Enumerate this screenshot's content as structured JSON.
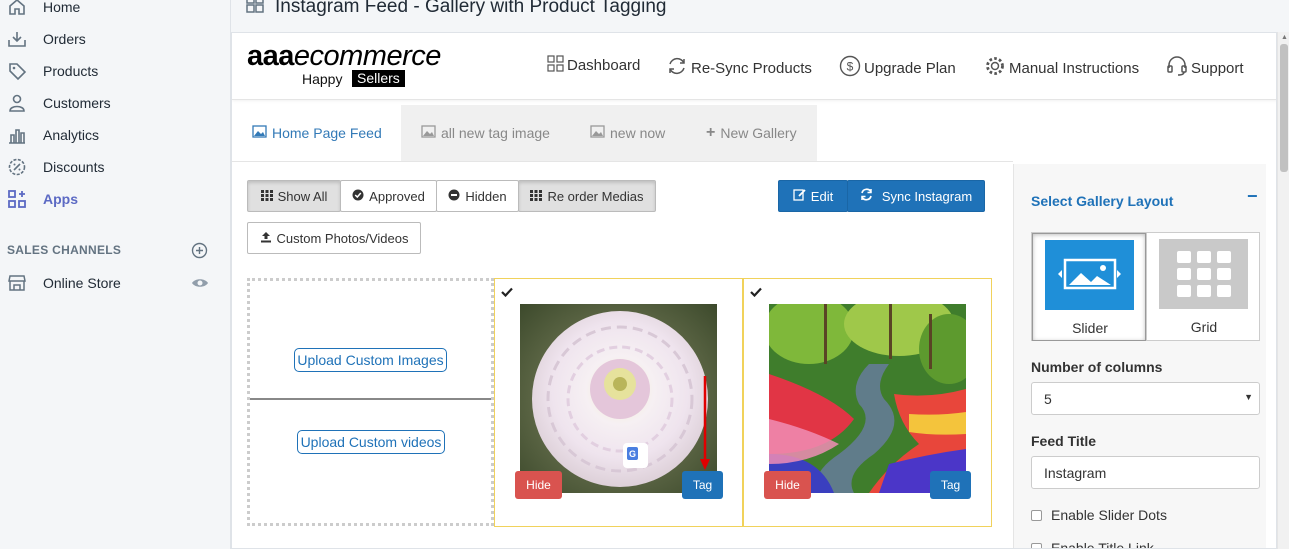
{
  "sidebar": {
    "items": [
      {
        "label": "Home",
        "icon": "home-icon"
      },
      {
        "label": "Orders",
        "icon": "orders-icon"
      },
      {
        "label": "Products",
        "icon": "tag-icon"
      },
      {
        "label": "Customers",
        "icon": "person-icon"
      },
      {
        "label": "Analytics",
        "icon": "bar-chart-icon"
      },
      {
        "label": "Discounts",
        "icon": "discount-icon"
      },
      {
        "label": "Apps",
        "icon": "apps-icon",
        "active": true
      }
    ],
    "sales_channels_label": "SALES CHANNELS",
    "online_store_label": "Online Store"
  },
  "page": {
    "title": "Instagram Feed - Gallery with Product Tagging"
  },
  "app": {
    "logo": {
      "brand_bold": "aaa",
      "brand_italic": "ecommerce",
      "tagline_1": "Happy",
      "tagline_2": "Sellers"
    },
    "header_nav": {
      "dashboard": "Dashboard",
      "resync": "Re-Sync Products",
      "upgrade": "Upgrade Plan",
      "manual": "Manual Instructions",
      "support": "Support"
    },
    "tabs": [
      {
        "label": "Home Page Feed",
        "active": true
      },
      {
        "label": "all new tag image"
      },
      {
        "label": "new now"
      },
      {
        "label": "New Gallery"
      }
    ],
    "toolbar": {
      "show_all": "Show All",
      "approved": "Approved",
      "hidden": "Hidden",
      "reorder": "Re order Medias",
      "edit": "Edit",
      "sync": "Sync Instagram",
      "custom": "Custom Photos/Videos"
    },
    "upload": {
      "images": "Upload Custom Images",
      "videos": "Upload Custom videos"
    },
    "cards": [
      {
        "hide": "Hide",
        "tag": "Tag",
        "image": "dahlia-flower"
      },
      {
        "hide": "Hide",
        "tag": "Tag",
        "image": "tulip-garden"
      }
    ],
    "panel": {
      "title": "Select Gallery Layout",
      "collapse": "−",
      "layouts": [
        {
          "label": "Slider",
          "selected": true
        },
        {
          "label": "Grid"
        }
      ],
      "columns_label": "Number of columns",
      "columns_value": "5",
      "feed_title_label": "Feed Title",
      "feed_title_value": "Instagram",
      "enable_slider_dots": "Enable Slider Dots",
      "enable_title_link": "Enable Title Link"
    }
  },
  "colors": {
    "accent": "#1f72b8",
    "danger": "#d9534f",
    "apps_active": "#5c6ac4",
    "card_border": "#f1d25b"
  }
}
